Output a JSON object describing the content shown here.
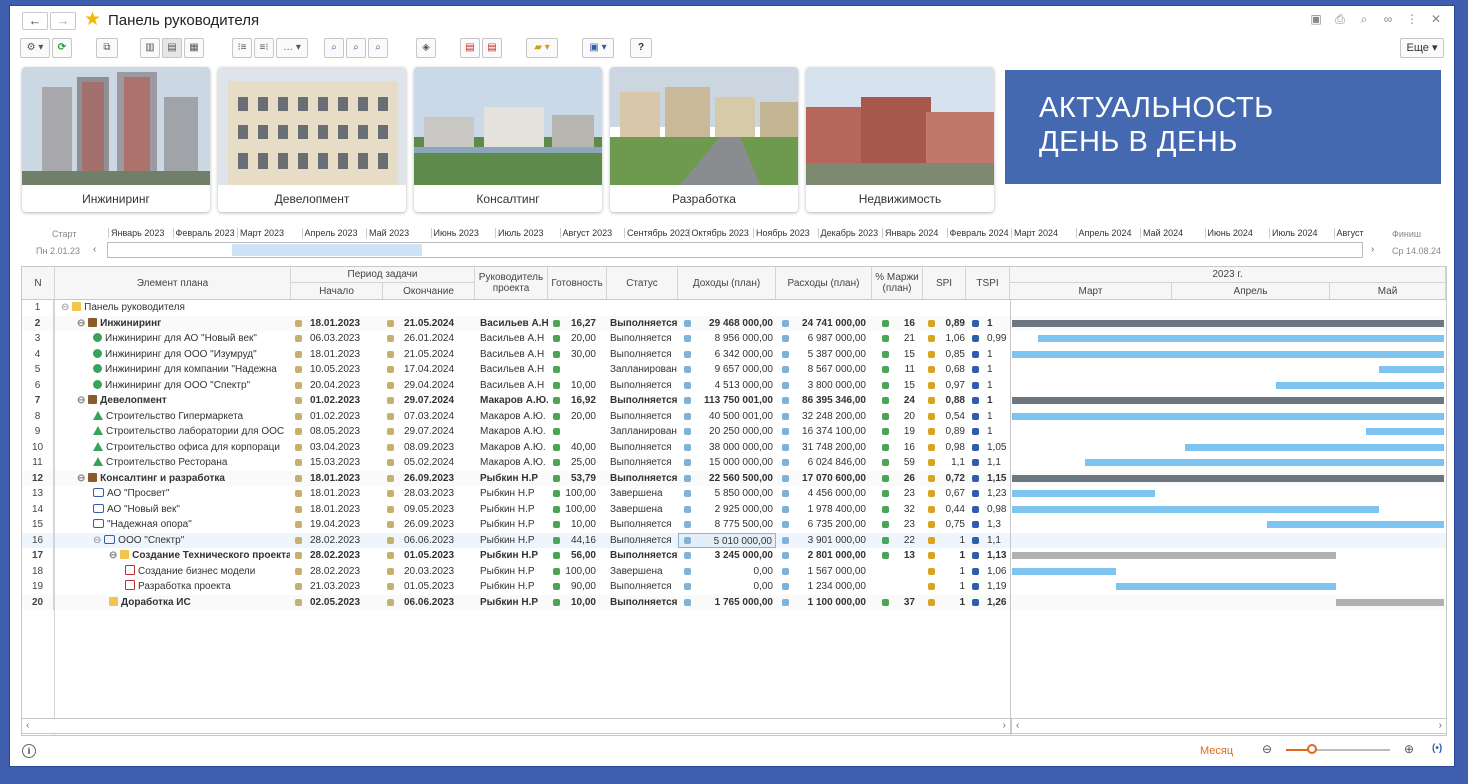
{
  "window": {
    "title": "Панель руководителя",
    "back_glyph": "←",
    "forward_glyph": "→",
    "more_label": "Еще"
  },
  "tiles": [
    {
      "label": "Инжиниринг"
    },
    {
      "label": "Девелопмент"
    },
    {
      "label": "Консалтинг"
    },
    {
      "label": "Разработка"
    },
    {
      "label": "Недвижимость"
    }
  ],
  "banner": {
    "line1": "АКТУАЛЬНОСТЬ",
    "line2": "ДЕНЬ В ДЕНЬ"
  },
  "timeline": {
    "start_label": "Старт",
    "start_date": "Пн 2.01.23",
    "finish_label": "Финиш",
    "finish_date": "Ср 14.08.24",
    "months": [
      "Январь 2023",
      "Февраль 2023",
      "Март 2023",
      "Апрель 2023",
      "Май 2023",
      "Июнь 2023",
      "Июль 2023",
      "Август 2023",
      "Сентябрь 2023",
      "Октябрь 2023",
      "Ноябрь 2023",
      "Декабрь 2023",
      "Январь 2024",
      "Февраль 2024",
      "Март 2024",
      "Апрель 2024",
      "Май 2024",
      "Июнь 2024",
      "Июль 2024",
      "Август"
    ]
  },
  "columns": {
    "n": "N",
    "element": "Элемент плана",
    "period": "Период задачи",
    "start": "Начало",
    "end": "Окончание",
    "manager": "Руководитель проекта",
    "ready": "Готовность",
    "status": "Статус",
    "income": "Доходы (план)",
    "expense": "Расходы (план)",
    "margin": "% Маржи (план)",
    "spi": "SPI",
    "tspi": "TSPI",
    "year": "2023 г.",
    "m1": "Март",
    "m2": "Апрель",
    "m3": "Май"
  },
  "rows": [
    {
      "n": "1",
      "indent": 0,
      "icon": "folder-blue",
      "name": "Панель руководителя",
      "start": "",
      "end": "",
      "mgr": "",
      "rdy": "",
      "stat": "",
      "dohod": "",
      "rashod": "",
      "marzh": "",
      "spi": "",
      "tspi": "",
      "sum": false
    },
    {
      "n": "2",
      "indent": 1,
      "icon": "case",
      "name": "Инжиниринг",
      "start": "18.01.2023",
      "end": "21.05.2024",
      "mgr": "Васильев А.Н",
      "rdy": "16,27",
      "stat": "Выполняется",
      "dohod": "29 468 000,00",
      "rashod": "24 741 000,00",
      "marzh": "16",
      "spi": "0,89",
      "tspi": "1",
      "sum": true,
      "bar": [
        0.0,
        1.0
      ],
      "barColor": "#6b7680"
    },
    {
      "n": "3",
      "indent": 2,
      "icon": "green",
      "name": "Инжиниринг для АО \"Новый век\"",
      "start": "06.03.2023",
      "end": "26.01.2024",
      "mgr": "Васильев А.Н",
      "rdy": "20,00",
      "stat": "Выполняется",
      "dohod": "8 956 000,00",
      "rashod": "6 987 000,00",
      "marzh": "21",
      "spi": "1,06",
      "tspi": "0,99",
      "sum": false,
      "bar": [
        0.06,
        1.0
      ],
      "barColor": "#7dc4f0"
    },
    {
      "n": "4",
      "indent": 2,
      "icon": "green",
      "name": "Инжиниринг для ООО \"Изумруд\"",
      "start": "18.01.2023",
      "end": "21.05.2024",
      "mgr": "Васильев А.Н",
      "rdy": "30,00",
      "stat": "Выполняется",
      "dohod": "6 342 000,00",
      "rashod": "5 387 000,00",
      "marzh": "15",
      "spi": "0,85",
      "tspi": "1",
      "sum": false,
      "bar": [
        0.0,
        1.0
      ],
      "barColor": "#7dc4f0"
    },
    {
      "n": "5",
      "indent": 2,
      "icon": "green",
      "name": "Инжиниринг для компании \"Надежна",
      "start": "10.05.2023",
      "end": "17.04.2024",
      "mgr": "Васильев А.Н",
      "rdy": "",
      "stat": "Запланирован",
      "dohod": "9 657 000,00",
      "rashod": "8 567 000,00",
      "marzh": "11",
      "spi": "0,68",
      "tspi": "1",
      "sum": false,
      "bar": [
        0.85,
        1.0
      ],
      "barColor": "#7dc4f0"
    },
    {
      "n": "6",
      "indent": 2,
      "icon": "green",
      "name": "Инжиниринг для ООО \"Спектр\"",
      "start": "20.04.2023",
      "end": "29.04.2024",
      "mgr": "Васильев А.Н",
      "rdy": "10,00",
      "stat": "Выполняется",
      "dohod": "4 513 000,00",
      "rashod": "3 800 000,00",
      "marzh": "15",
      "spi": "0,97",
      "tspi": "1",
      "sum": false,
      "bar": [
        0.61,
        1.0
      ],
      "barColor": "#7dc4f0"
    },
    {
      "n": "7",
      "indent": 1,
      "icon": "case",
      "name": "Девелопмент",
      "start": "01.02.2023",
      "end": "29.07.2024",
      "mgr": "Макаров А.Ю.",
      "rdy": "16,92",
      "stat": "Выполняется",
      "dohod": "113 750 001,00",
      "rashod": "86 395 346,00",
      "marzh": "24",
      "spi": "0,88",
      "tspi": "1",
      "sum": true,
      "bar": [
        0.0,
        1.0
      ],
      "barColor": "#6b7680"
    },
    {
      "n": "8",
      "indent": 2,
      "icon": "house",
      "name": "Строительство Гипермаркета",
      "start": "01.02.2023",
      "end": "07.03.2024",
      "mgr": "Макаров А.Ю.",
      "rdy": "20,00",
      "stat": "Выполняется",
      "dohod": "40 500 001,00",
      "rashod": "32 248 200,00",
      "marzh": "20",
      "spi": "0,54",
      "tspi": "1",
      "sum": false,
      "bar": [
        0.0,
        1.0
      ],
      "barColor": "#7dc4f0"
    },
    {
      "n": "9",
      "indent": 2,
      "icon": "house",
      "name": "Строительство лаборатории для ООС",
      "start": "08.05.2023",
      "end": "29.07.2024",
      "mgr": "Макаров А.Ю.",
      "rdy": "",
      "stat": "Запланирован",
      "dohod": "20 250 000,00",
      "rashod": "16 374 100,00",
      "marzh": "19",
      "spi": "0,89",
      "tspi": "1",
      "sum": false,
      "bar": [
        0.82,
        1.0
      ],
      "barColor": "#7dc4f0"
    },
    {
      "n": "10",
      "indent": 2,
      "icon": "house",
      "name": "Строительство офиса для корпораци",
      "start": "03.04.2023",
      "end": "08.09.2023",
      "mgr": "Макаров А.Ю.",
      "rdy": "40,00",
      "stat": "Выполняется",
      "dohod": "38 000 000,00",
      "rashod": "31 748 200,00",
      "marzh": "16",
      "spi": "0,98",
      "tspi": "1,05",
      "sum": false,
      "bar": [
        0.4,
        1.0
      ],
      "barColor": "#7dc4f0"
    },
    {
      "n": "11",
      "indent": 2,
      "icon": "house",
      "name": "Строительство Ресторана",
      "start": "15.03.2023",
      "end": "05.02.2024",
      "mgr": "Макаров А.Ю.",
      "rdy": "25,00",
      "stat": "Выполняется",
      "dohod": "15 000 000,00",
      "rashod": "6 024 846,00",
      "marzh": "59",
      "spi": "1,1",
      "tspi": "1,1",
      "sum": false,
      "bar": [
        0.17,
        1.0
      ],
      "barColor": "#7dc4f0"
    },
    {
      "n": "12",
      "indent": 1,
      "icon": "case",
      "name": "Консалтинг и разработка",
      "start": "18.01.2023",
      "end": "26.09.2023",
      "mgr": "Рыбкин Н.Р",
      "rdy": "53,79",
      "stat": "Выполняется",
      "dohod": "22 560 500,00",
      "rashod": "17 070 600,00",
      "marzh": "26",
      "spi": "0,72",
      "tspi": "1,15",
      "sum": true,
      "bar": [
        0.0,
        1.0
      ],
      "barColor": "#6b7680"
    },
    {
      "n": "13",
      "indent": 2,
      "icon": "chat",
      "name": "АО \"Просвет\"",
      "start": "18.01.2023",
      "end": "28.03.2023",
      "mgr": "Рыбкин Н.Р",
      "rdy": "100,00",
      "stat": "Завершена",
      "dohod": "5 850 000,00",
      "rashod": "4 456 000,00",
      "marzh": "23",
      "spi": "0,67",
      "tspi": "1,23",
      "sum": false,
      "bar": [
        0.0,
        0.33
      ],
      "barColor": "#7dc4f0"
    },
    {
      "n": "14",
      "indent": 2,
      "icon": "chat",
      "name": "АО \"Новый век\"",
      "start": "18.01.2023",
      "end": "09.05.2023",
      "mgr": "Рыбкин Н.Р",
      "rdy": "100,00",
      "stat": "Завершена",
      "dohod": "2 925 000,00",
      "rashod": "1 978 400,00",
      "marzh": "32",
      "spi": "0,44",
      "tspi": "0,98",
      "sum": false,
      "bar": [
        0.0,
        0.85
      ],
      "barColor": "#7dc4f0"
    },
    {
      "n": "15",
      "indent": 2,
      "icon": "chat",
      "name": "\"Надежная опора\"",
      "start": "19.04.2023",
      "end": "26.09.2023",
      "mgr": "Рыбкин Н.Р",
      "rdy": "10,00",
      "stat": "Выполняется",
      "dohod": "8 775 500,00",
      "rashod": "6 735 200,00",
      "marzh": "23",
      "spi": "0,75",
      "tspi": "1,3",
      "sum": false,
      "bar": [
        0.59,
        1.0
      ],
      "barColor": "#7dc4f0"
    },
    {
      "n": "16",
      "indent": 2,
      "icon": "chat",
      "name": "ООО \"Спектр\"",
      "start": "28.02.2023",
      "end": "06.06.2023",
      "mgr": "Рыбкин Н.Р",
      "rdy": "44,16",
      "stat": "Выполняется",
      "dohod": "5 010 000,00",
      "rashod": "3 901 000,00",
      "marzh": "22",
      "spi": "1",
      "tspi": "1,1",
      "sum": false,
      "sel": true
    },
    {
      "n": "17",
      "indent": 3,
      "icon": "folder",
      "name": "Создание Технического проекта",
      "start": "28.02.2023",
      "end": "01.05.2023",
      "mgr": "Рыбкин Н.Р",
      "rdy": "56,00",
      "stat": "Выполняется",
      "dohod": "3 245 000,00",
      "rashod": "2 801 000,00",
      "marzh": "13",
      "spi": "1",
      "tspi": "1,13",
      "sum": true,
      "bar": [
        0.0,
        0.75
      ],
      "barColor": "#b0b0b0"
    },
    {
      "n": "18",
      "indent": 4,
      "icon": "red",
      "name": "Создание бизнес модели",
      "start": "28.02.2023",
      "end": "20.03.2023",
      "mgr": "Рыбкин Н.Р",
      "rdy": "100,00",
      "stat": "Завершена",
      "dohod": "0,00",
      "rashod": "1 567 000,00",
      "marzh": "",
      "spi": "1",
      "tspi": "1,06",
      "sum": false,
      "bar": [
        0.0,
        0.24
      ],
      "barColor": "#7dc4f0"
    },
    {
      "n": "19",
      "indent": 4,
      "icon": "red",
      "name": "Разработка проекта",
      "start": "21.03.2023",
      "end": "01.05.2023",
      "mgr": "Рыбкин Н.Р",
      "rdy": "90,00",
      "stat": "Выполняется",
      "dohod": "0,00",
      "rashod": "1 234 000,00",
      "marzh": "",
      "spi": "1",
      "tspi": "1,19",
      "sum": false,
      "bar": [
        0.24,
        0.75
      ],
      "barColor": "#7dc4f0"
    },
    {
      "n": "20",
      "indent": 3,
      "icon": "folder",
      "name": "Доработка ИС",
      "start": "02.05.2023",
      "end": "06.06.2023",
      "mgr": "Рыбкин Н.Р",
      "rdy": "10,00",
      "stat": "Выполняется",
      "dohod": "1 765 000,00",
      "rashod": "1 100 000,00",
      "marzh": "37",
      "spi": "1",
      "tspi": "1,26",
      "sum": true,
      "bar": [
        0.75,
        1.0
      ],
      "barColor": "#b0b0b0"
    }
  ],
  "footer": {
    "scale_label": "Месяц",
    "info_glyph": "i"
  }
}
